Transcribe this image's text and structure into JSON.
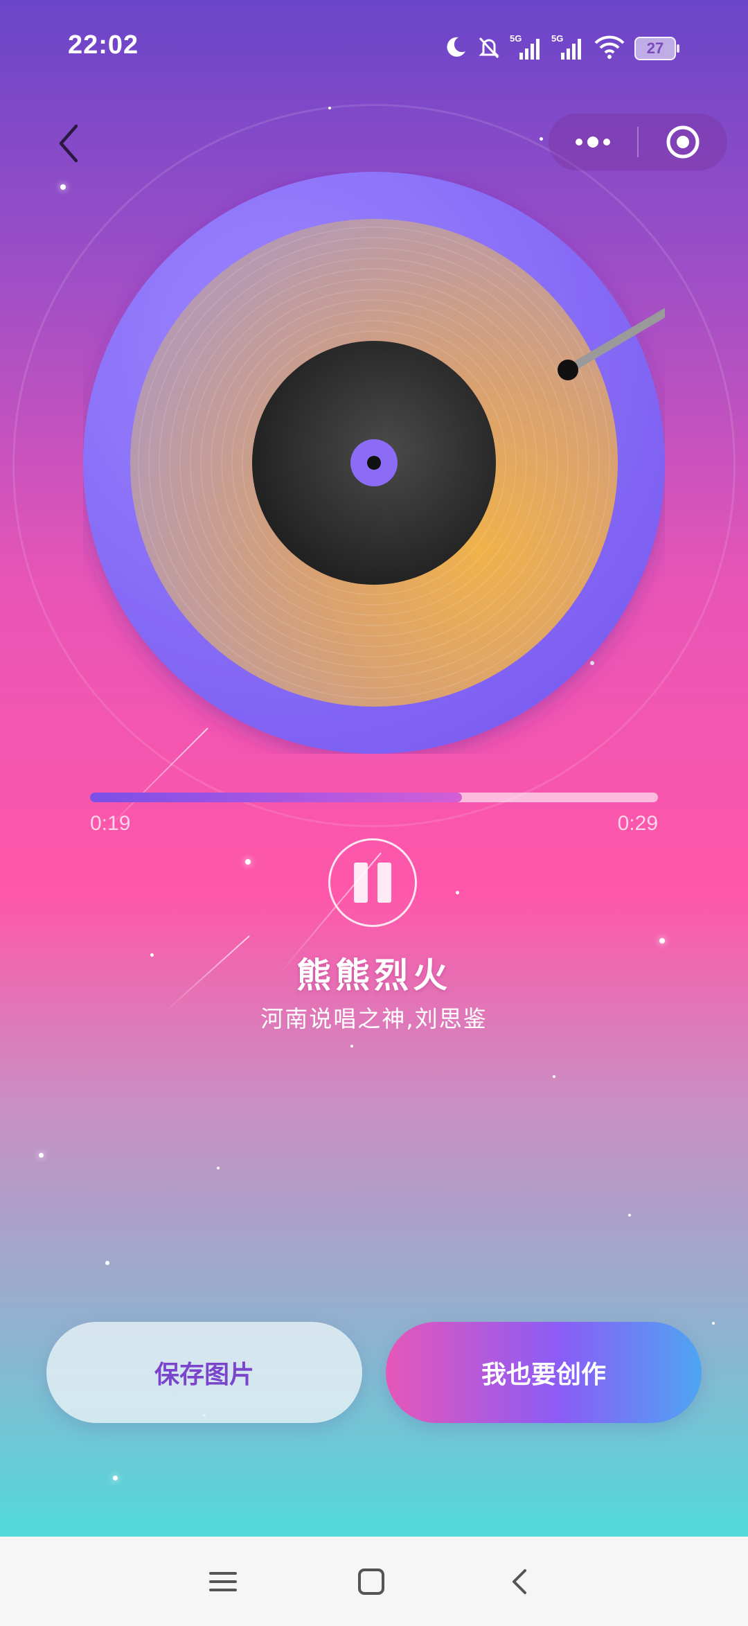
{
  "status_bar": {
    "time": "22:02",
    "battery": "27",
    "icons": [
      "moon-icon",
      "bell-off-icon",
      "signal-5g-icon",
      "signal-5g-icon",
      "wifi-icon"
    ]
  },
  "header": {
    "back_icon": "chevron-left-icon",
    "capsule": {
      "more_icon": "more-dots-icon",
      "close_icon": "target-circle-icon"
    }
  },
  "player": {
    "elapsed": "0:19",
    "duration": "0:29",
    "progress": 0.655,
    "state_icon": "pause-icon"
  },
  "song": {
    "title": "熊熊烈火",
    "artist": "河南说唱之神,刘思鉴"
  },
  "actions": {
    "save_label": "保存图片",
    "create_label": "我也要创作"
  },
  "nav": {
    "menu_icon": "menu-icon",
    "home_icon": "home-square-icon",
    "back_icon": "back-chevron-icon"
  },
  "colors": {
    "accent_purple": "#8b5cf6",
    "accent_pink": "#ff57a9",
    "accent_teal": "#36ebdf",
    "record_gold": "#e7a75a"
  }
}
